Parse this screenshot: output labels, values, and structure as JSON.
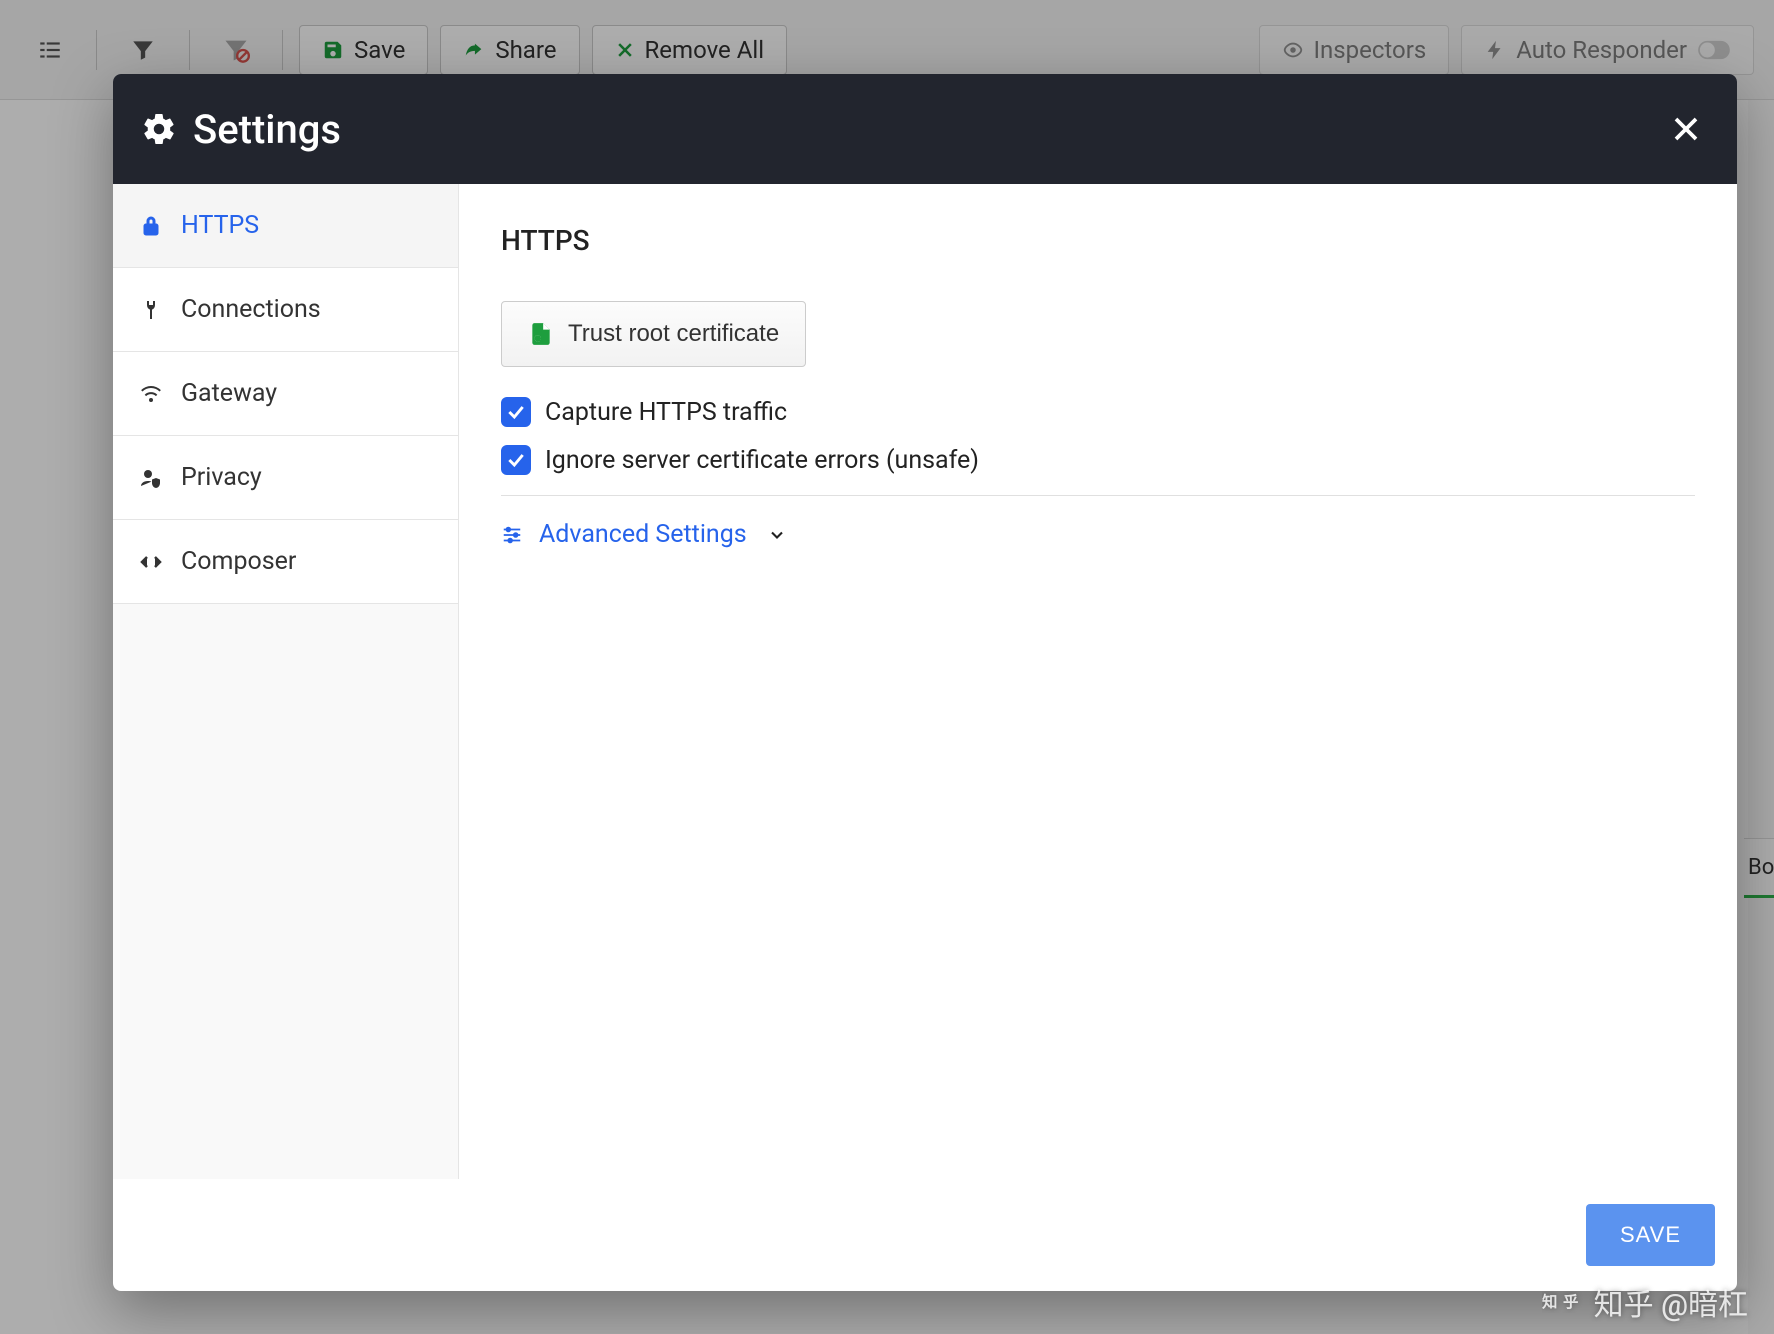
{
  "bg_toolbar": {
    "save": "Save",
    "share": "Share",
    "remove_all": "Remove All",
    "inspectors": "Inspectors",
    "auto_responder": "Auto Responder"
  },
  "bg_right_tab": "Bo",
  "dialog": {
    "title": "Settings"
  },
  "sidebar": {
    "items": [
      {
        "label": "HTTPS",
        "icon": "lock"
      },
      {
        "label": "Connections",
        "icon": "plug"
      },
      {
        "label": "Gateway",
        "icon": "wifi"
      },
      {
        "label": "Privacy",
        "icon": "user-shield"
      },
      {
        "label": "Composer",
        "icon": "code"
      }
    ]
  },
  "main": {
    "heading": "HTTPS",
    "trust_button": "Trust root certificate",
    "capture_label": "Capture HTTPS traffic",
    "capture_checked": true,
    "ignore_label": "Ignore server certificate errors (unsafe)",
    "ignore_checked": true,
    "advanced_label": "Advanced Settings"
  },
  "footer": {
    "save": "SAVE"
  },
  "watermark": "知乎 @暗杠"
}
